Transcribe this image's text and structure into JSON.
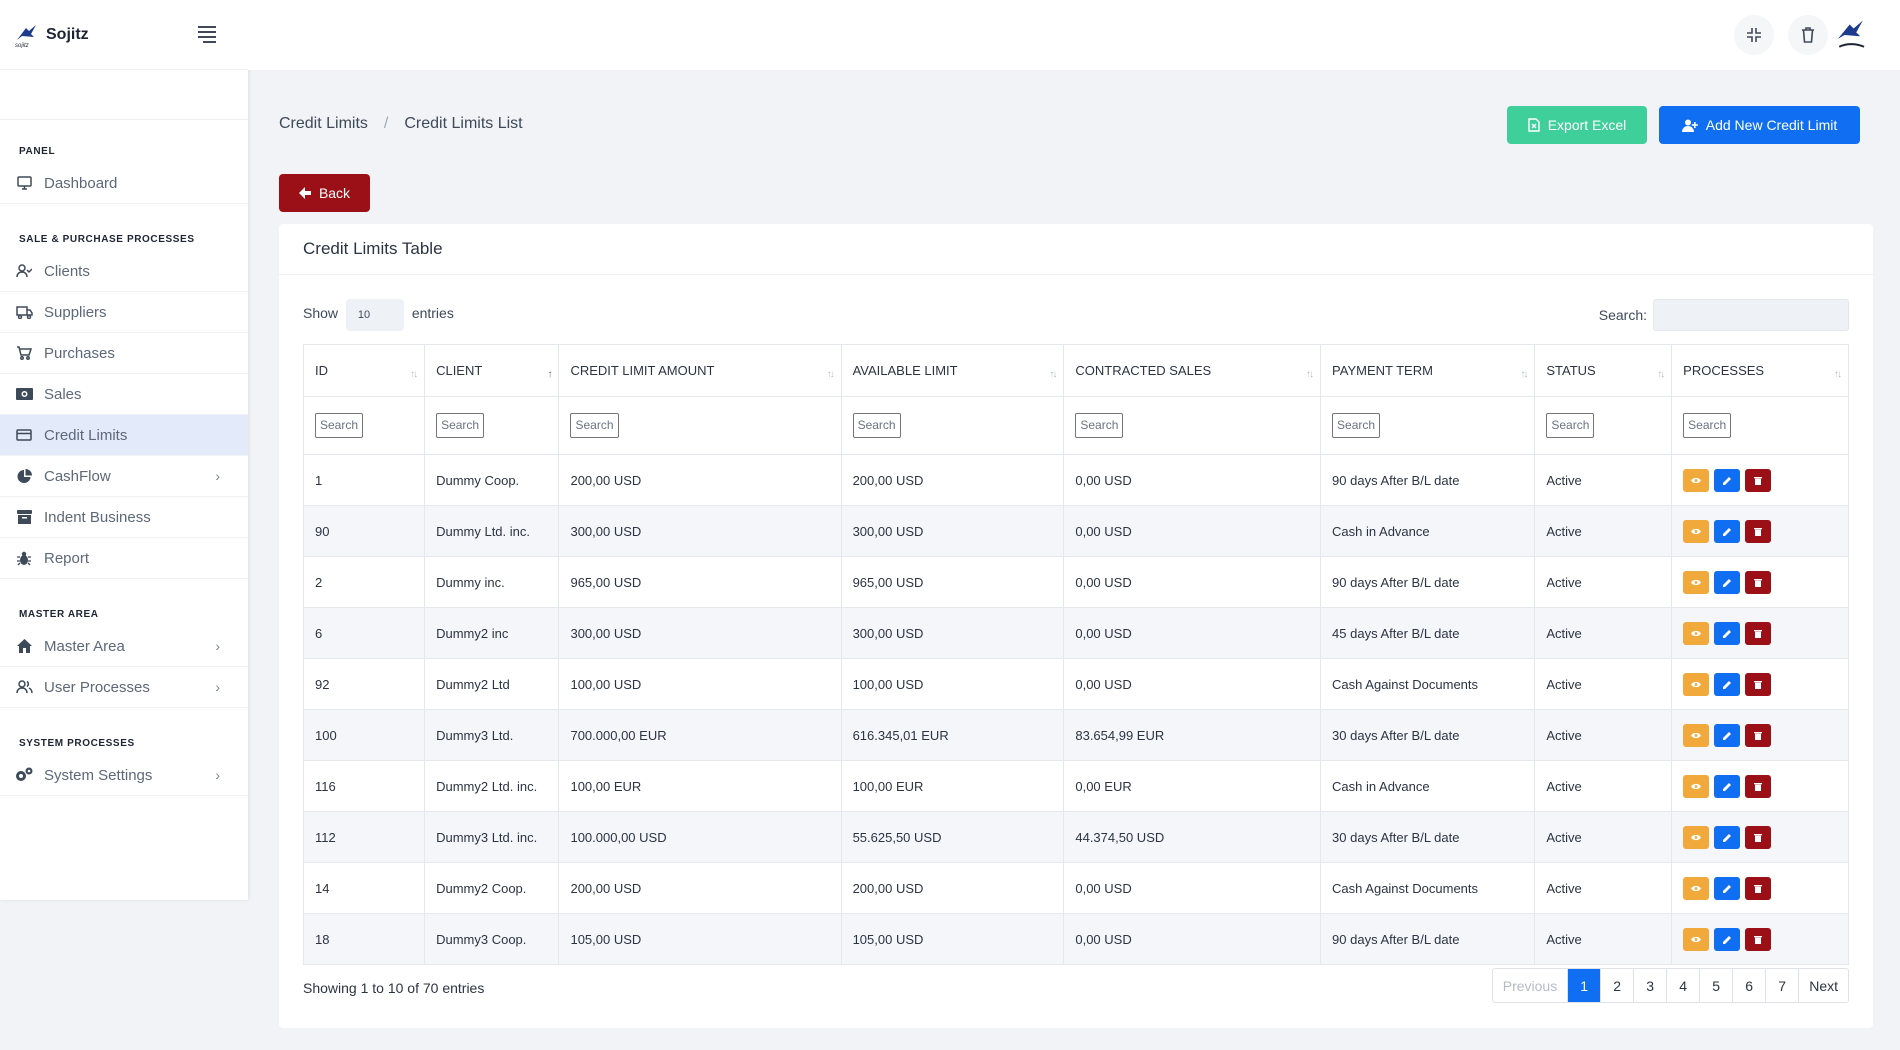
{
  "brand": {
    "name": "Sojitz",
    "sub": "sojitz"
  },
  "sidebar": {
    "sections": [
      {
        "title": "PANEL",
        "items": [
          {
            "label": "Dashboard",
            "icon": "monitor-icon"
          }
        ]
      },
      {
        "title": "SALE & PURCHASE PROCESSES",
        "items": [
          {
            "label": "Clients",
            "icon": "user-check-icon"
          },
          {
            "label": "Suppliers",
            "icon": "truck-icon"
          },
          {
            "label": "Purchases",
            "icon": "cart-icon"
          },
          {
            "label": "Sales",
            "icon": "money-icon"
          },
          {
            "label": "Credit Limits",
            "icon": "credit-card-icon",
            "active": true
          },
          {
            "label": "CashFlow",
            "icon": "pie-chart-icon",
            "chevron": true
          },
          {
            "label": "Indent Business",
            "icon": "archive-icon"
          },
          {
            "label": "Report",
            "icon": "bug-icon"
          }
        ]
      },
      {
        "title": "MASTER AREA",
        "items": [
          {
            "label": "Master Area",
            "icon": "home-icon",
            "chevron": true
          },
          {
            "label": "User Processes",
            "icon": "users-icon",
            "chevron": true
          }
        ]
      },
      {
        "title": "SYSTEM PROCESSES",
        "items": [
          {
            "label": "System Settings",
            "icon": "cogs-icon",
            "chevron": true
          }
        ]
      }
    ]
  },
  "header": {
    "breadcrumb": [
      "Credit Limits",
      "Credit Limits List"
    ],
    "export_label": "Export Excel",
    "add_label": "Add New Credit Limit",
    "back_label": "Back"
  },
  "card": {
    "title": "Credit Limits Table",
    "show_label": "Show",
    "entries_value": "10",
    "entries_label": "entries",
    "search_label": "Search:",
    "column_search_placeholder": "Search"
  },
  "table": {
    "columns": [
      "ID",
      "CLIENT",
      "CREDIT LIMIT AMOUNT",
      "AVAILABLE LIMIT",
      "CONTRACTED SALES",
      "PAYMENT TERM",
      "STATUS",
      "PROCESSES"
    ],
    "rows": [
      [
        "1",
        "Dummy Coop.",
        "200,00 USD",
        "200,00 USD",
        "0,00 USD",
        "90 days After B/L date",
        "Active"
      ],
      [
        "90",
        "Dummy Ltd. inc.",
        "300,00 USD",
        "300,00 USD",
        "0,00 USD",
        "Cash in Advance",
        "Active"
      ],
      [
        "2",
        "Dummy inc.",
        "965,00 USD",
        "965,00 USD",
        "0,00 USD",
        "90 days After B/L date",
        "Active"
      ],
      [
        "6",
        "Dummy2 inc",
        "300,00 USD",
        "300,00 USD",
        "0,00 USD",
        "45 days After B/L date",
        "Active"
      ],
      [
        "92",
        "Dummy2 Ltd",
        "100,00 USD",
        "100,00 USD",
        "0,00 USD",
        "Cash Against Documents",
        "Active"
      ],
      [
        "100",
        "Dummy3 Ltd.",
        "700.000,00 EUR",
        "616.345,01 EUR",
        "83.654,99 EUR",
        "30 days After B/L date",
        "Active"
      ],
      [
        "116",
        "Dummy2 Ltd. inc.",
        "100,00 EUR",
        "100,00 EUR",
        "0,00 EUR",
        "Cash in Advance",
        "Active"
      ],
      [
        "112",
        "Dummy3 Ltd. inc.",
        "100.000,00 USD",
        "55.625,50 USD",
        "44.374,50 USD",
        "30 days After B/L date",
        "Active"
      ],
      [
        "14",
        "Dummy2 Coop.",
        "200,00 USD",
        "200,00 USD",
        "0,00 USD",
        "Cash Against Documents",
        "Active"
      ],
      [
        "18",
        "Dummy3 Coop.",
        "105,00 USD",
        "105,00 USD",
        "0,00 USD",
        "90 days After B/L date",
        "Active"
      ]
    ]
  },
  "footer": {
    "info": "Showing 1 to 10 of 70 entries",
    "pages": [
      "Previous",
      "1",
      "2",
      "3",
      "4",
      "5",
      "6",
      "7",
      "Next"
    ],
    "active_page": "1"
  },
  "colors": {
    "primary": "#0f6ef2",
    "success": "#3ecf9a",
    "danger": "#9b1016",
    "warning": "#f2a93b",
    "status_active": "#2d9a35"
  }
}
